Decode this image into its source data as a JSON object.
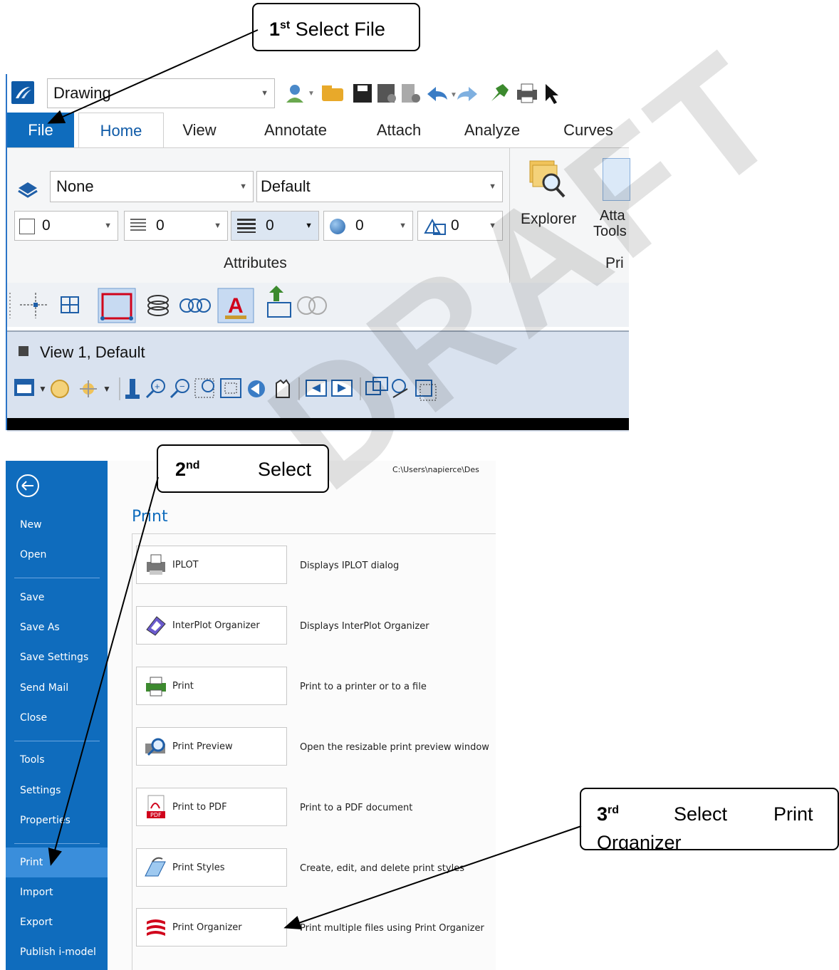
{
  "callouts": {
    "step1": {
      "num": "1",
      "sup": "st",
      "text": "Select File"
    },
    "step2": {
      "num": "2",
      "sup": "nd",
      "text": "Select"
    },
    "step3": {
      "num": "3",
      "sup": "rd",
      "text1": "Select",
      "text2": "Print",
      "text3": "Organizer"
    }
  },
  "watermark": "DRAFT",
  "qat": {
    "combo_value": "Drawing"
  },
  "tabs": [
    "File",
    "Home",
    "View",
    "Annotate",
    "Attach",
    "Analyze",
    "Curves"
  ],
  "ribbon": {
    "level_combo": "None",
    "style_combo": "Default",
    "small_combos": [
      "0",
      "0",
      "0",
      "0",
      "0"
    ],
    "group_attributes": "Attributes",
    "explorer_label": "Explorer",
    "attach_tools_line1": "Atta",
    "attach_tools_line2": "Tools",
    "group_primary_cut": "Pri"
  },
  "view_window": {
    "title": "View 1, Default"
  },
  "backstage": {
    "items": [
      "New",
      "Open",
      "Save",
      "Save As",
      "Save Settings",
      "Send Mail",
      "Close",
      "Tools",
      "Settings",
      "Properties",
      "Print",
      "Import",
      "Export",
      "Publish i-model"
    ],
    "selected": "Print",
    "path": "C:\\Users\\napierce\\Des",
    "heading": "Print"
  },
  "print_options": [
    {
      "label": "IPLOT",
      "desc": "Displays IPLOT dialog",
      "icon": "printer-iplot-icon"
    },
    {
      "label": "InterPlot Organizer",
      "desc": "Displays InterPlot Organizer",
      "icon": "interplot-organizer-icon"
    },
    {
      "label": "Print",
      "desc": "Print to a printer or to a file",
      "icon": "printer-icon"
    },
    {
      "label": "Print Preview",
      "desc": "Open the resizable print preview window",
      "icon": "print-preview-icon"
    },
    {
      "label": "Print to PDF",
      "desc": "Print to a PDF document",
      "icon": "pdf-icon"
    },
    {
      "label": "Print Styles",
      "desc": "Create, edit, and delete print styles",
      "icon": "print-styles-icon"
    },
    {
      "label": "Print Organizer",
      "desc": "Print multiple files using Print Organizer",
      "icon": "print-organizer-icon"
    }
  ],
  "pdf_icon_text": "PDF",
  "colors": {
    "accent": "#0f6cbd",
    "selected": "#3a8edb",
    "home_tab_text": "#0e5aa7"
  }
}
